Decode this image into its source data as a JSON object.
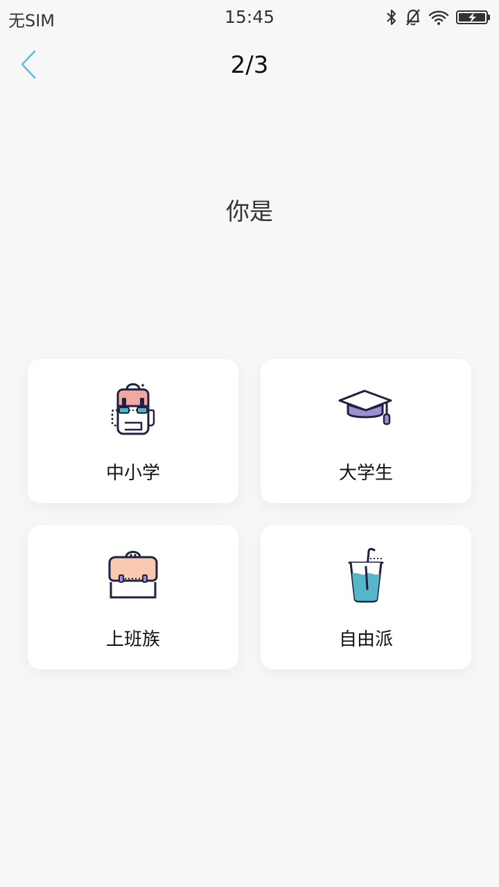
{
  "status_bar": {
    "carrier": "无SIM",
    "time": "15:45",
    "icons": [
      "bluetooth-icon",
      "mute-bell-icon",
      "wifi-icon",
      "battery-charging-icon"
    ]
  },
  "nav": {
    "back_icon": "chevron-left-icon",
    "step": "2/3"
  },
  "question": "你是",
  "options": [
    {
      "label": "中小学",
      "icon": "backpack-icon"
    },
    {
      "label": "大学生",
      "icon": "graduation-cap-icon"
    },
    {
      "label": "上班族",
      "icon": "briefcase-icon"
    },
    {
      "label": "自由派",
      "icon": "drink-cup-icon"
    }
  ],
  "colors": {
    "background": "#f7f7f7",
    "card": "#ffffff",
    "accent_back": "#5bbde3",
    "backpack": "#f2a8a0",
    "backpack_strap": "#4bb5c8",
    "cap": "#9f8fd0",
    "briefcase": "#f8c9ae",
    "drink": "#57b6c9",
    "outline": "#1e2140"
  }
}
